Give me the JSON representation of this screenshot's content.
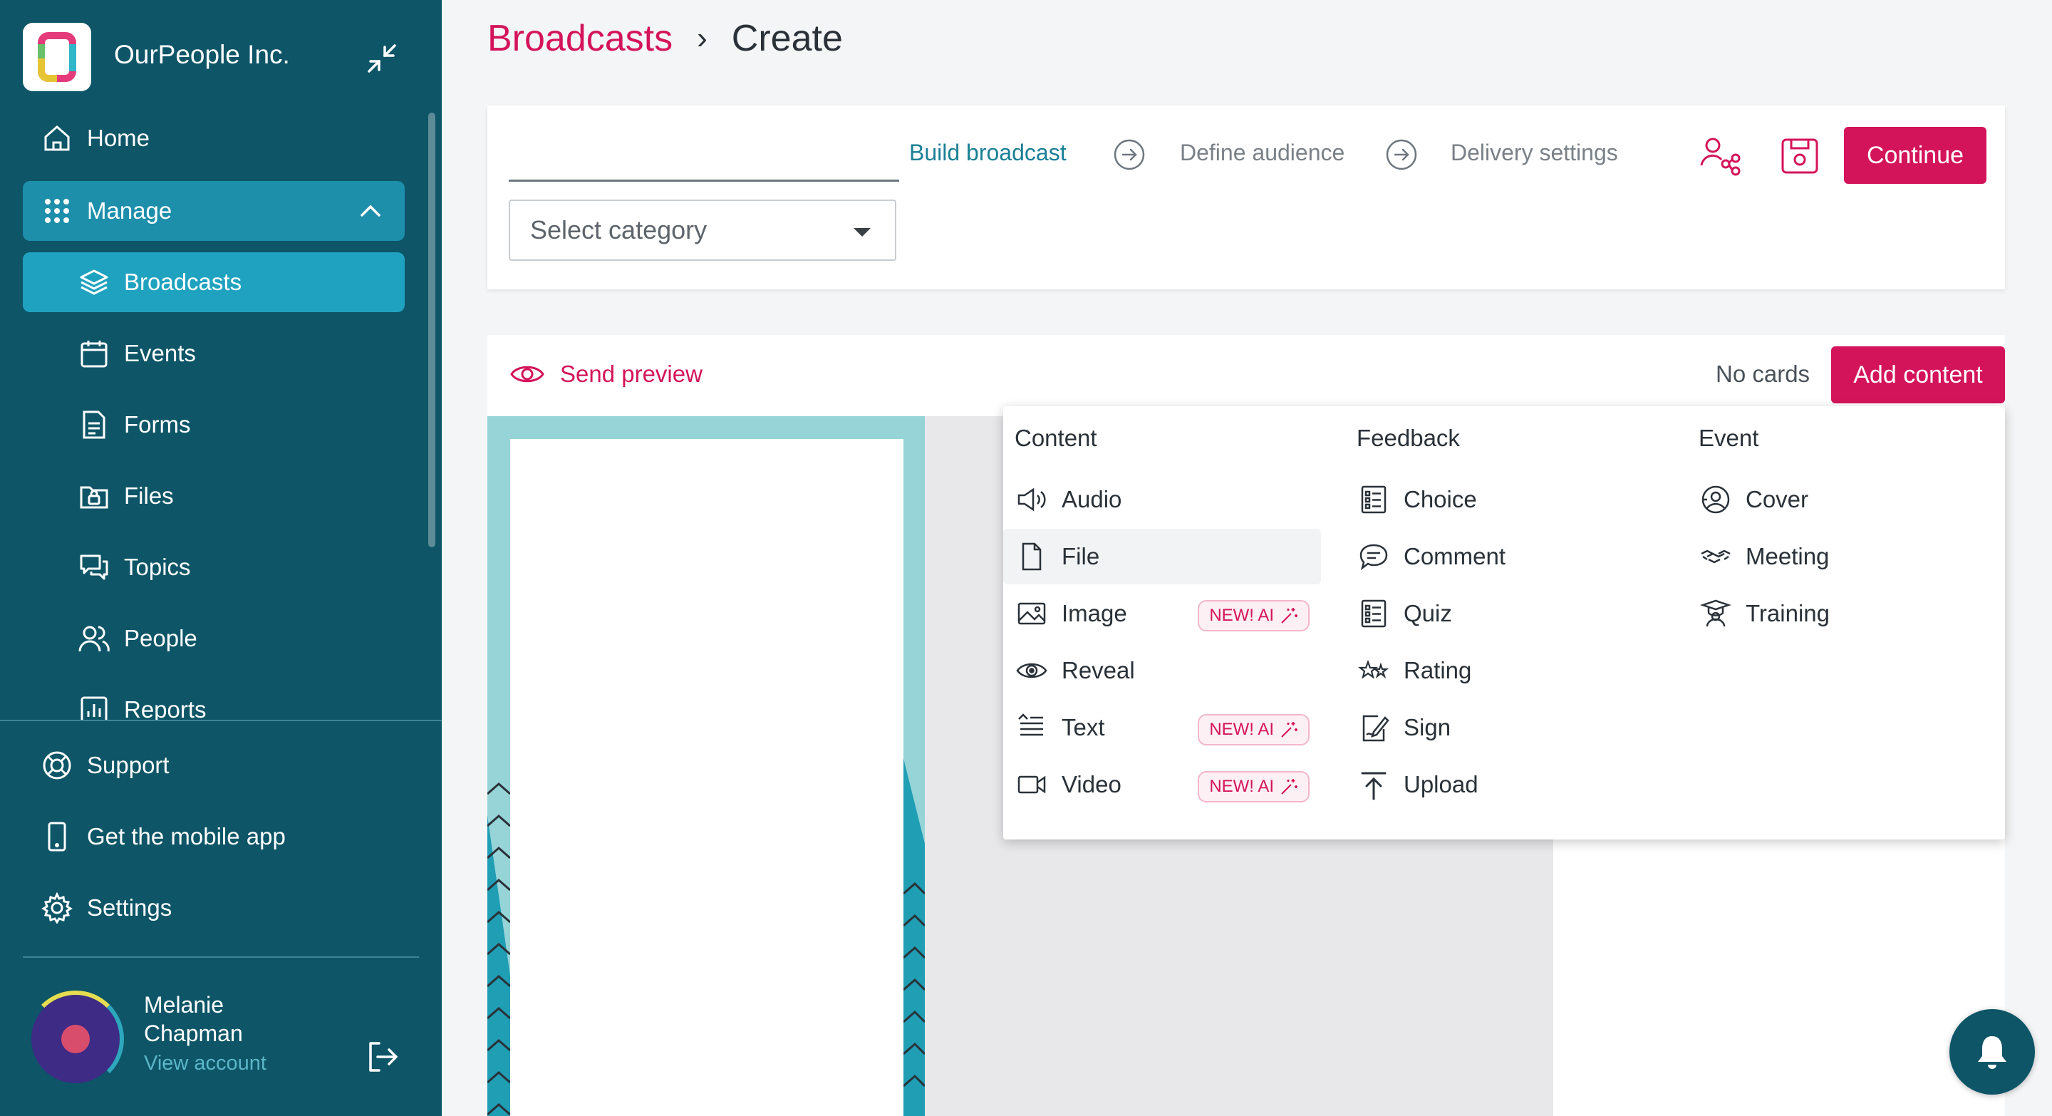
{
  "org": {
    "name": "OurPeople Inc."
  },
  "sidebar": {
    "items": [
      {
        "label": "Home"
      },
      {
        "label": "Manage"
      },
      {
        "label": "Broadcasts"
      },
      {
        "label": "Events"
      },
      {
        "label": "Forms"
      },
      {
        "label": "Files"
      },
      {
        "label": "Topics"
      },
      {
        "label": "People"
      },
      {
        "label": "Reports"
      }
    ],
    "bottom": [
      {
        "label": "Support"
      },
      {
        "label": "Get the mobile app"
      },
      {
        "label": "Settings"
      }
    ],
    "user": {
      "name": "Melanie Chapman",
      "link": "View account"
    }
  },
  "breadcrumb": {
    "parent": "Broadcasts",
    "separator": "›",
    "current": "Create"
  },
  "builder": {
    "title_value": "",
    "category_placeholder": "Select category",
    "steps": [
      {
        "label": "Build broadcast",
        "active": true
      },
      {
        "label": "Define audience",
        "active": false
      },
      {
        "label": "Delivery settings",
        "active": false
      }
    ],
    "continue_label": "Continue"
  },
  "content_bar": {
    "send_preview": "Send preview",
    "card_count": "No cards",
    "add_content": "Add content"
  },
  "add_menu": {
    "columns": [
      {
        "heading": "Content",
        "items": [
          {
            "label": "Audio",
            "icon": "speaker-icon"
          },
          {
            "label": "File",
            "icon": "file-icon"
          },
          {
            "label": "Image",
            "icon": "image-icon",
            "badge": "NEW! AI"
          },
          {
            "label": "Reveal",
            "icon": "eye-icon"
          },
          {
            "label": "Text",
            "icon": "text-icon",
            "badge": "NEW! AI"
          },
          {
            "label": "Video",
            "icon": "video-icon",
            "badge": "NEW! AI"
          }
        ]
      },
      {
        "heading": "Feedback",
        "items": [
          {
            "label": "Choice",
            "icon": "list-icon"
          },
          {
            "label": "Comment",
            "icon": "comment-icon"
          },
          {
            "label": "Quiz",
            "icon": "quiz-icon"
          },
          {
            "label": "Rating",
            "icon": "star-icon"
          },
          {
            "label": "Sign",
            "icon": "sign-icon"
          },
          {
            "label": "Upload",
            "icon": "upload-icon"
          }
        ]
      },
      {
        "heading": "Event",
        "items": [
          {
            "label": "Cover",
            "icon": "cover-icon"
          },
          {
            "label": "Meeting",
            "icon": "meeting-icon"
          },
          {
            "label": "Training",
            "icon": "training-icon"
          }
        ]
      }
    ]
  },
  "colors": {
    "primary": "#d4145a",
    "sidebar": "#0d5567",
    "accent": "#1fa2bf"
  }
}
